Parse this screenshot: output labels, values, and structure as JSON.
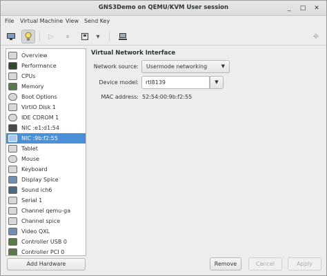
{
  "window": {
    "title": "GNS3Demo on QEMU/KVM User session",
    "controls": [
      "_",
      "□",
      "✕"
    ]
  },
  "menu": [
    "File",
    "Virtual Machine",
    "View",
    "Send Key"
  ],
  "toolbar": {
    "buttons": [
      "monitor-icon",
      "lightbulb-icon",
      "play-icon",
      "pause-icon",
      "power-icon",
      "dropdown-arrow-icon",
      "snapshot-icon",
      "fullscreen-icon"
    ]
  },
  "sidebar": {
    "items": [
      {
        "label": "Overview",
        "icon": "info-icon"
      },
      {
        "label": "Performance",
        "icon": "performance-icon"
      },
      {
        "label": "CPUs",
        "icon": "cpu-icon"
      },
      {
        "label": "Memory",
        "icon": "memory-icon"
      },
      {
        "label": "Boot Options",
        "icon": "gear-icon"
      },
      {
        "label": "VirtIO Disk 1",
        "icon": "disk-icon"
      },
      {
        "label": "IDE CDROM 1",
        "icon": "cdrom-icon"
      },
      {
        "label": "NIC :e1:d1:54",
        "icon": "nic-icon"
      },
      {
        "label": "NIC :9b:f2:55",
        "icon": "nic-icon",
        "selected": true
      },
      {
        "label": "Tablet",
        "icon": "tablet-icon"
      },
      {
        "label": "Mouse",
        "icon": "mouse-icon"
      },
      {
        "label": "Keyboard",
        "icon": "keyboard-icon"
      },
      {
        "label": "Display Spice",
        "icon": "display-icon"
      },
      {
        "label": "Sound ich6",
        "icon": "sound-icon"
      },
      {
        "label": "Serial 1",
        "icon": "serial-icon"
      },
      {
        "label": "Channel qemu-ga",
        "icon": "channel-icon"
      },
      {
        "label": "Channel spice",
        "icon": "channel-icon"
      },
      {
        "label": "Video QXL",
        "icon": "video-icon"
      },
      {
        "label": "Controller USB 0",
        "icon": "controller-icon"
      },
      {
        "label": "Controller PCI 0",
        "icon": "controller-icon"
      }
    ],
    "add_hardware": "Add Hardware"
  },
  "details": {
    "section_title": "Virtual Network Interface",
    "network_source_label": "Network source:",
    "network_source_value": "Usermode networking",
    "device_model_label": "Device model:",
    "device_model_value": "rtl8139",
    "mac_label": "MAC address:",
    "mac_value": "52:54:00:9b:f2:55"
  },
  "buttons": {
    "remove": "Remove",
    "cancel": "Cancel",
    "apply": "Apply"
  }
}
